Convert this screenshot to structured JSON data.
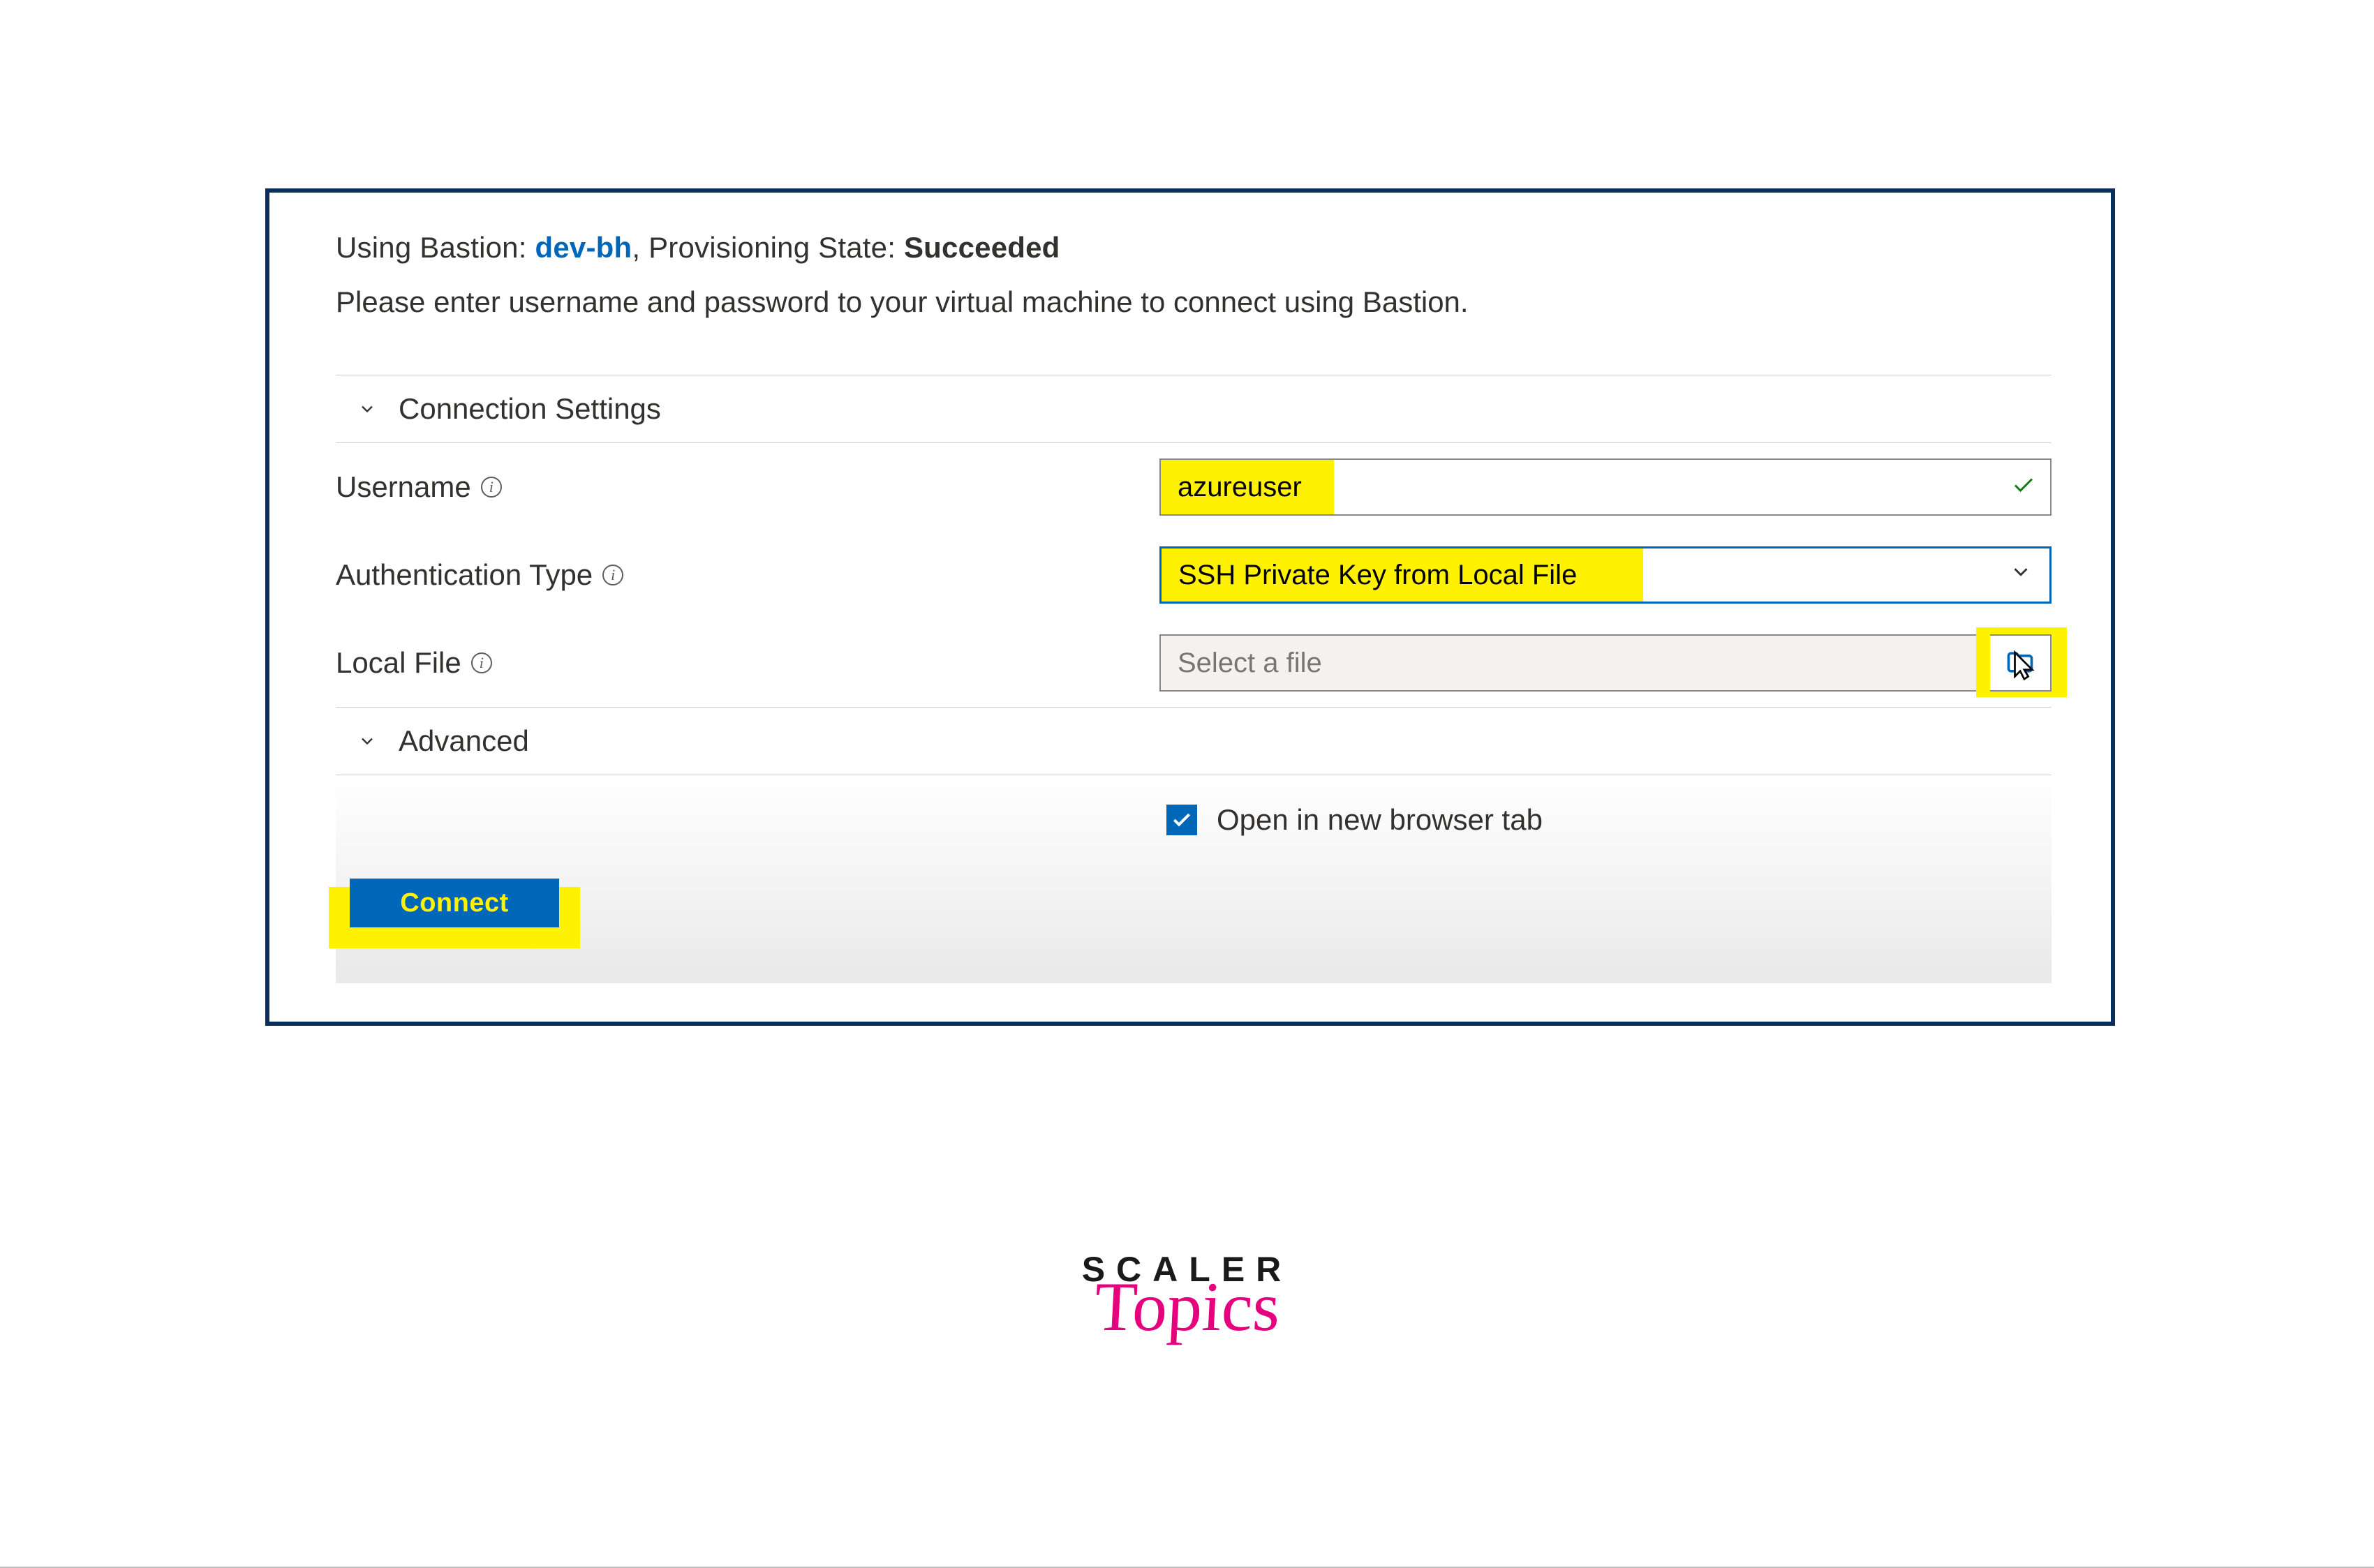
{
  "header": {
    "prefix": "Using Bastion: ",
    "bastion_name": "dev-bh",
    "mid": ", Provisioning State: ",
    "state": "Succeeded"
  },
  "instruction": "Please enter username and password to your virtual machine to connect using Bastion.",
  "sections": {
    "connection": "Connection Settings",
    "advanced": "Advanced"
  },
  "fields": {
    "username_label": "Username",
    "username_value": "azureuser",
    "auth_label": "Authentication Type",
    "auth_value": "SSH Private Key from Local File",
    "file_label": "Local File",
    "file_placeholder": "Select a file"
  },
  "checkbox": {
    "label": "Open in new browser tab",
    "checked": true
  },
  "buttons": {
    "connect": "Connect"
  },
  "brand": {
    "top": "SCALER",
    "bottom": "Topics"
  },
  "icons": {
    "info": "i"
  }
}
